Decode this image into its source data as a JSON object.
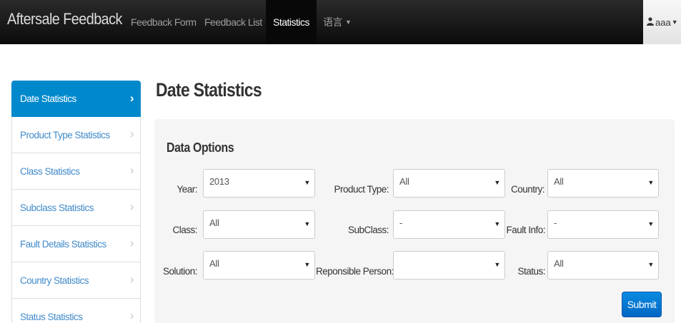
{
  "navbar": {
    "brand": "Aftersale Feedback",
    "items": [
      {
        "label": "Feedback Form"
      },
      {
        "label": "Feedback List"
      },
      {
        "label": "Statistics",
        "active": true
      },
      {
        "label": "语言"
      }
    ],
    "user": "aaa"
  },
  "sidebar": {
    "items": [
      {
        "label": "Date Statistics",
        "active": true
      },
      {
        "label": "Product Type Statistics"
      },
      {
        "label": "Class Statistics"
      },
      {
        "label": "Subclass Statistics"
      },
      {
        "label": "Fault Details Statistics"
      },
      {
        "label": "Country Statistics"
      },
      {
        "label": "Status Statistics"
      }
    ]
  },
  "main": {
    "title": "Date Statistics",
    "section_title": "Data Options",
    "fields": {
      "year": {
        "label": "Year:",
        "value": "2013"
      },
      "product_type": {
        "label": "Product Type:",
        "value": "All"
      },
      "country": {
        "label": "Country:",
        "value": "All"
      },
      "class": {
        "label": "Class:",
        "value": "All"
      },
      "subclass": {
        "label": "SubClass:",
        "value": "-"
      },
      "fault_info": {
        "label": "Fault Info:",
        "value": "-"
      },
      "solution": {
        "label": "Solution:",
        "value": "All"
      },
      "responsible_person": {
        "label": "Reponsible Person:",
        "value": ""
      },
      "status": {
        "label": "Status:",
        "value": "All"
      }
    },
    "submit_label": "Submit"
  },
  "icons": {
    "chevron": "›",
    "caret": "▼",
    "user": "user-icon"
  },
  "colors": {
    "active_sidebar": "#0088cc",
    "link": "#428bca",
    "submit": "#0a7ad6",
    "navbar": "#111111"
  }
}
